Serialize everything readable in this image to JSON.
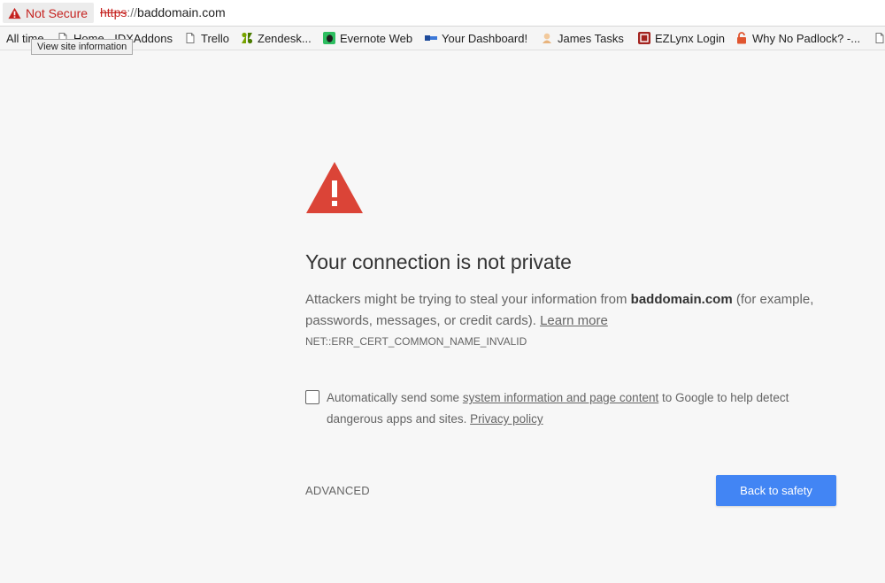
{
  "omnibox": {
    "security_label": "Not Secure",
    "url_scheme": "https",
    "url_separator": "://",
    "url_host": "baddomain.com",
    "tooltip": "View site information"
  },
  "bookmarks": [
    {
      "label": "All time",
      "icon": "none"
    },
    {
      "label": "Home - IDXAddons",
      "icon": "page-icon"
    },
    {
      "label": "Trello",
      "icon": "page-icon"
    },
    {
      "label": "Zendesk...",
      "icon": "zendesk-icon"
    },
    {
      "label": "Evernote Web",
      "icon": "evernote-icon"
    },
    {
      "label": "Your Dashboard!",
      "icon": "dashboard-icon"
    },
    {
      "label": "James Tasks",
      "icon": "avatar-icon"
    },
    {
      "label": "EZLynx Login",
      "icon": "ezlynx-icon"
    },
    {
      "label": "Why No Padlock? -...",
      "icon": "padlock-icon"
    }
  ],
  "interstitial": {
    "title": "Your connection is not private",
    "body_prefix": "Attackers might be trying to steal your information from ",
    "domain": "baddomain.com",
    "body_suffix": " (for example, passwords, messages, or credit cards). ",
    "learn_more": "Learn more",
    "error_code": "NET::ERR_CERT_COMMON_NAME_INVALID",
    "optin_prefix": "Automatically send some ",
    "optin_link": "system information and page content",
    "optin_middle": " to Google to help detect dangerous apps and sites. ",
    "privacy_link": "Privacy policy",
    "advanced_label": "ADVANCED",
    "safety_label": "Back to safety"
  },
  "colors": {
    "danger": "#db4437",
    "accent_button": "#4285f4",
    "page_background": "#f7f7f7"
  }
}
